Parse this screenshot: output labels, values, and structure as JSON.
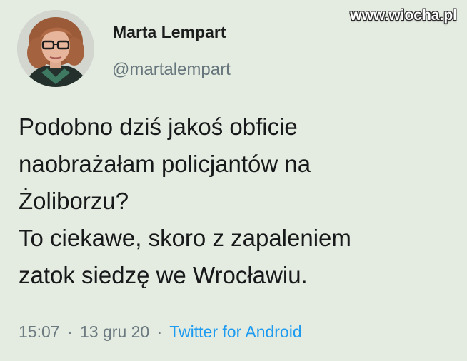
{
  "author": {
    "display_name": "Marta Lempart",
    "handle": "@martalempart"
  },
  "watermark": "www.wiocha.pl",
  "tweet": {
    "lines": [
      "Podobno dziś jakoś obficie",
      "naobrażałam policjantów na",
      "Żoliborzu?",
      "To ciekawe, skoro z zapaleniem",
      "zatok siedzę we Wrocławiu."
    ]
  },
  "meta": {
    "time": "15:07",
    "date": "13 gru 20",
    "separator": "·",
    "source": "Twitter for Android"
  },
  "colors": {
    "background": "#e4ebe0",
    "link": "#1d9bf0",
    "secondary_text": "#66767c"
  }
}
